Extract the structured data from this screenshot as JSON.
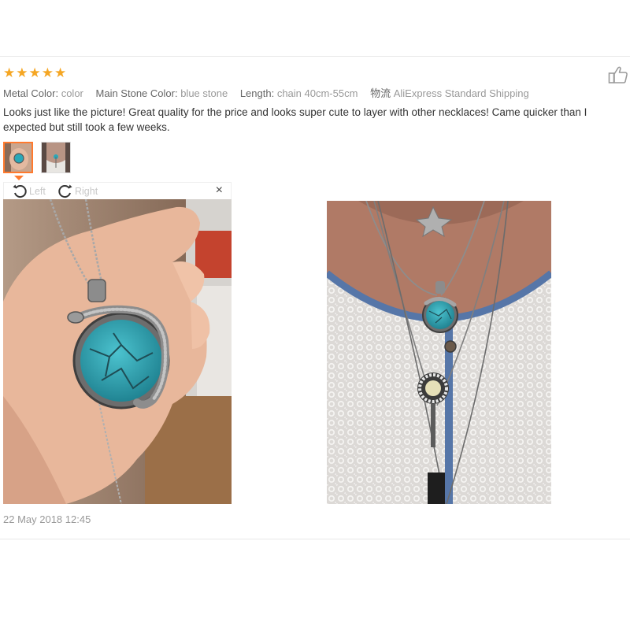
{
  "review": {
    "rating": 5,
    "specs": [
      {
        "key": "Metal Color:",
        "value": "color"
      },
      {
        "key": "Main Stone Color:",
        "value": "blue stone"
      },
      {
        "key": "Length:",
        "value": "chain 40cm-55cm"
      },
      {
        "key": "物流",
        "value": "AliExpress Standard Shipping"
      }
    ],
    "text": "Looks just like the picture! Great quality for the price and looks super cute to layer with other necklaces! Came quicker than I expected but still took a few weeks.",
    "timestamp": "22 May 2018 12:45"
  },
  "viewer": {
    "rotate_left_label": "Left",
    "rotate_right_label": "Right",
    "close_glyph": "×"
  },
  "icons": {
    "star": "star-icon",
    "helpful": "thumbs-up-icon",
    "rotate_left": "rotate-left-icon",
    "rotate_right": "rotate-right-icon",
    "close": "close-icon"
  },
  "colors": {
    "star": "#f5a623",
    "active_thumb_border": "#ff7a2e",
    "turquoise": "#2aa8b8"
  }
}
